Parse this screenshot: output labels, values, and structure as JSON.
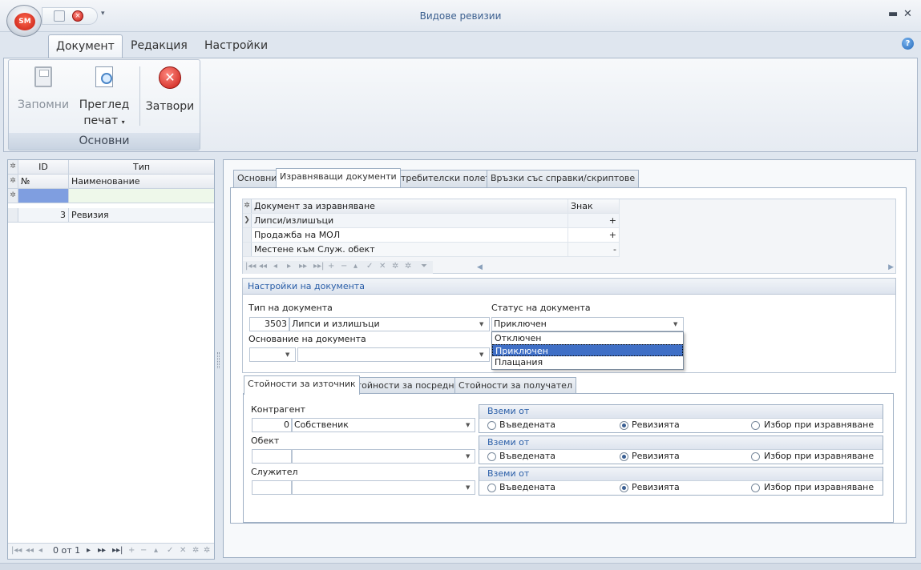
{
  "window": {
    "title": "Видове ревизии",
    "logo_text": "SM",
    "minimize_glyph": "▬",
    "close_glyph": "✕"
  },
  "ribbon": {
    "tabs": [
      "Документ",
      "Редакция",
      "Настройки"
    ],
    "active_tab": "Документ",
    "group_caption": "Основни",
    "buttons": {
      "save": "Запомни",
      "preview_line1": "Преглед",
      "preview_line2": "печат",
      "close": "Затвори"
    }
  },
  "left_grid": {
    "header_row1": {
      "id": "ID",
      "type": "Тип"
    },
    "header_row2": {
      "num": "№",
      "name": "Наименование"
    },
    "rows": [
      {
        "num": "3",
        "name": "Ревизия"
      }
    ],
    "nav_record": "0 от 1"
  },
  "right_tabs": [
    "Основни",
    "Изравняващи документи",
    "Потребителски полета",
    "Връзки със справки/скриптове"
  ],
  "active_right_tab": "Изравняващи документи",
  "compare_grid": {
    "headers": {
      "document": "Документ за изравняване",
      "sign": "Знак"
    },
    "rows": [
      {
        "document": "Липси/излишъци",
        "sign": "+"
      },
      {
        "document": "Продажба на МОЛ",
        "sign": "+"
      },
      {
        "document": "Местене към Служ. обект",
        "sign": "-"
      }
    ]
  },
  "doc_settings": {
    "title": "Настройки на документа",
    "doc_type_label": "Тип на документа",
    "doc_type_code": "3503",
    "doc_type_name": "Липси и излишъци",
    "status_label": "Статус на документа",
    "status_value": "Приключен",
    "basis_label": "Основание на документа",
    "status_options": [
      "Отключен",
      "Приключен",
      "Плащания"
    ],
    "status_selected_index": 1
  },
  "value_tabs": [
    "Стойности за източник",
    "Стойности за посредник",
    "Стойности за получател"
  ],
  "active_value_tab": "Стойности за източник",
  "source": {
    "counterparty_label": "Контрагент",
    "counterparty_code": "0",
    "counterparty_name": "Собственик",
    "object_label": "Обект",
    "employee_label": "Служител",
    "take_from_title": "Вземи от",
    "radio_options": [
      "Въведената",
      "Ревизията",
      "Избор при изравняване"
    ],
    "radio_selected": "Ревизията"
  }
}
